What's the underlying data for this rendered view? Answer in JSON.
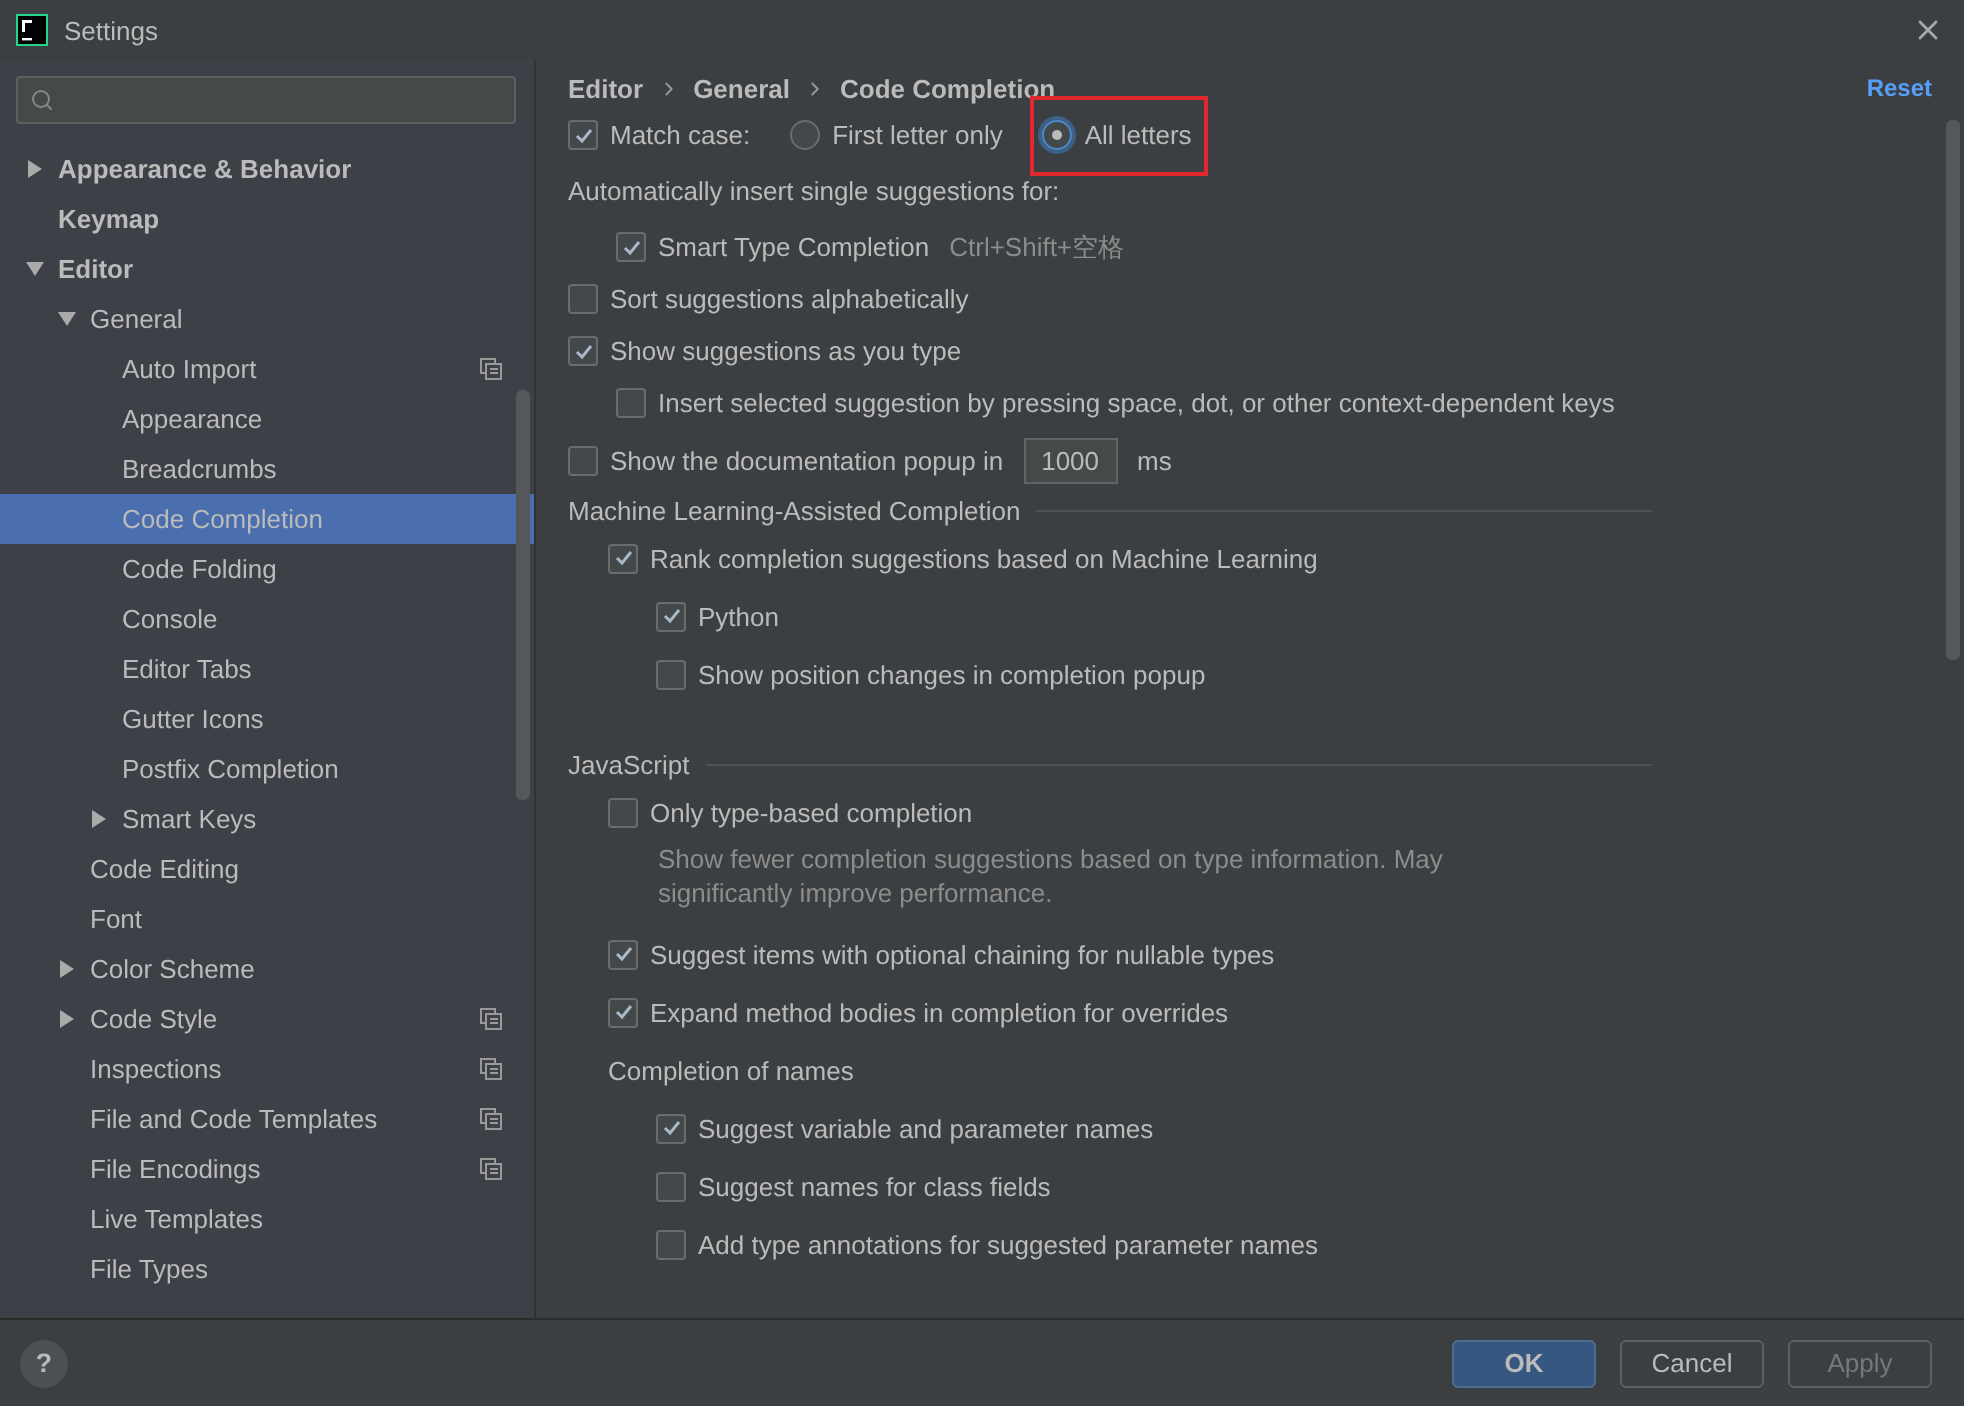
{
  "window": {
    "title": "Settings"
  },
  "sidebar": {
    "items": [
      {
        "label": "Appearance & Behavior",
        "expanded": false,
        "selected": false
      },
      {
        "label": "Keymap",
        "selected": false
      },
      {
        "label": "Editor",
        "expanded": true,
        "selected": false,
        "children": [
          {
            "label": "General",
            "expanded": true,
            "selected": false,
            "children": [
              {
                "label": "Auto Import",
                "project_level": true,
                "selected": false
              },
              {
                "label": "Appearance",
                "selected": false
              },
              {
                "label": "Breadcrumbs",
                "selected": false
              },
              {
                "label": "Code Completion",
                "selected": true
              },
              {
                "label": "Code Folding",
                "selected": false
              },
              {
                "label": "Console",
                "selected": false
              },
              {
                "label": "Editor Tabs",
                "selected": false
              },
              {
                "label": "Gutter Icons",
                "selected": false
              },
              {
                "label": "Postfix Completion",
                "selected": false
              },
              {
                "label": "Smart Keys",
                "expanded": false,
                "selected": false
              }
            ]
          },
          {
            "label": "Code Editing",
            "selected": false
          },
          {
            "label": "Font",
            "selected": false
          },
          {
            "label": "Color Scheme",
            "expanded": false,
            "selected": false
          },
          {
            "label": "Code Style",
            "expanded": false,
            "project_level": true,
            "selected": false
          },
          {
            "label": "Inspections",
            "project_level": true,
            "selected": false
          },
          {
            "label": "File and Code Templates",
            "project_level": true,
            "selected": false
          },
          {
            "label": "File Encodings",
            "project_level": true,
            "selected": false
          },
          {
            "label": "Live Templates",
            "selected": false
          },
          {
            "label": "File Types",
            "selected": false
          }
        ]
      }
    ]
  },
  "breadcrumb": [
    "Editor",
    "General",
    "Code Completion"
  ],
  "reset": "Reset",
  "items": [
    {
      "kind": "radio-row",
      "label": "Match case:",
      "checked": true,
      "options": [
        {
          "label": "First letter only",
          "selected": false,
          "highlighted": false
        },
        {
          "label": "All letters",
          "selected": true,
          "highlighted": true
        }
      ]
    },
    {
      "kind": "label",
      "text": "Automatically insert single suggestions for:",
      "children": [
        {
          "kind": "checkbox",
          "label": "Smart Type Completion",
          "shortcut": "Ctrl+Shift+空格",
          "checked": true
        }
      ]
    },
    {
      "kind": "checkbox",
      "label": "Sort suggestions alphabetically",
      "checked": false
    },
    {
      "kind": "checkbox",
      "label": "Show suggestions as you type",
      "checked": true,
      "children": [
        {
          "kind": "checkbox",
          "label": "Insert selected suggestion by pressing space, dot, or other context-dependent keys",
          "checked": false
        }
      ]
    },
    {
      "kind": "number-row",
      "label": "Show the documentation popup in",
      "value": "1000",
      "unit": "ms",
      "checked": false
    },
    {
      "kind": "section",
      "text": "Machine Learning-Assisted Completion",
      "children": [
        {
          "kind": "checkbox",
          "label": "Rank completion suggestions based on Machine Learning",
          "checked": true,
          "children": [
            {
              "kind": "checkbox",
              "label": "Python",
              "checked": true
            },
            {
              "kind": "checkbox",
              "label": "Show position changes in completion popup",
              "checked": false
            }
          ]
        }
      ]
    },
    {
      "kind": "section",
      "text": "JavaScript",
      "children": [
        {
          "kind": "checkbox",
          "label": "Only type-based completion",
          "checked": false,
          "description": "Show fewer completion suggestions based on type information. May significantly improve performance."
        },
        {
          "kind": "checkbox",
          "label": "Suggest items with optional chaining for nullable types",
          "checked": true
        },
        {
          "kind": "checkbox",
          "label": "Expand method bodies in completion for overrides",
          "checked": true
        },
        {
          "kind": "label",
          "text": "Completion of names",
          "children": [
            {
              "kind": "checkbox",
              "label": "Suggest variable and parameter names",
              "checked": true
            },
            {
              "kind": "checkbox",
              "label": "Suggest names for class fields",
              "checked": false
            },
            {
              "kind": "checkbox",
              "label": "Add type annotations for suggested parameter names",
              "checked": false
            }
          ]
        }
      ]
    }
  ],
  "footer": {
    "help": "?",
    "buttons": [
      {
        "label": "OK",
        "default": true,
        "disabled": false
      },
      {
        "label": "Cancel",
        "default": false,
        "disabled": false
      },
      {
        "label": "Apply",
        "default": false,
        "disabled": true
      }
    ]
  }
}
